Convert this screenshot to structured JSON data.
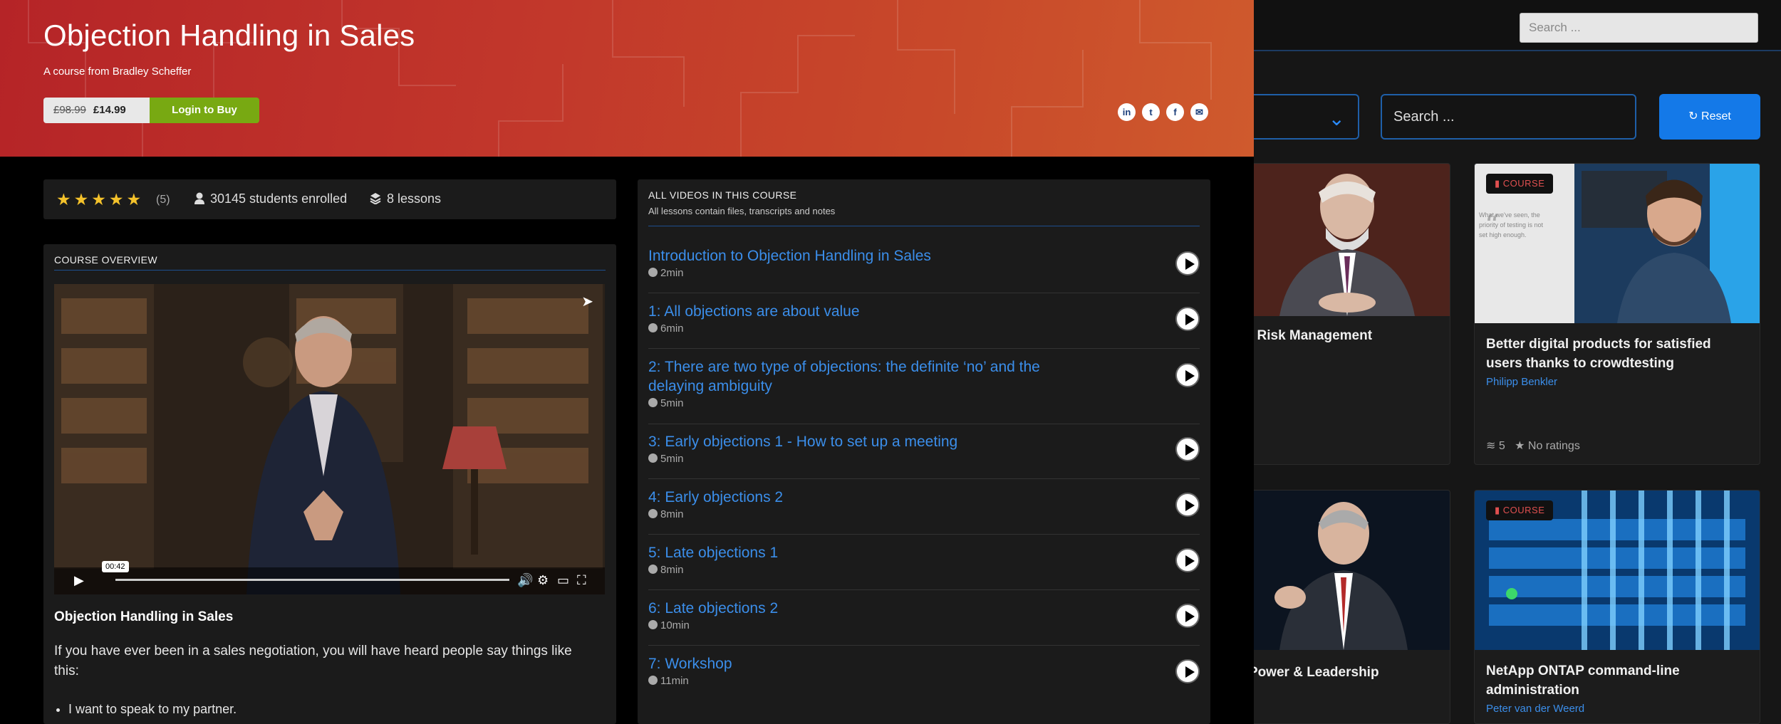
{
  "background": {
    "search_top_placeholder": "Search ...",
    "search_main_placeholder": "Search ...",
    "reset_label": "Reset",
    "cards": [
      {
        "title": "ctor: Risk Management",
        "author": "",
        "meta": "",
        "badge": ""
      },
      {
        "badge": "COURSE",
        "title": "Better digital products for satisfied users thanks to crowdtesting",
        "author": "Philipp Benkler",
        "lessons": "5",
        "rating": "No ratings"
      },
      {
        "title": "fer: Power & Leadership",
        "badge": ""
      },
      {
        "badge": "COURSE",
        "title": "NetApp ONTAP command-line administration",
        "author": "Peter van der Weerd"
      }
    ],
    "quote_text": "What we've seen, the priority of testing is not set high enough."
  },
  "course": {
    "title": "Objection Handling in Sales",
    "subtitle": "A course from Bradley Scheffer",
    "price_old": "£98.99",
    "price_new": "£14.99",
    "buy_label": "Login to Buy",
    "share_icons": [
      "linkedin-icon",
      "twitter-icon",
      "facebook-icon",
      "email-icon"
    ],
    "rating_count": "(5)",
    "students": "30145 students enrolled",
    "lessons_count": "8 lessons",
    "stars": 5
  },
  "overview": {
    "heading": "COURSE OVERVIEW",
    "video_time": "00:42",
    "title": "Objection Handling in Sales",
    "body": "If you have ever been in a sales negotiation, you will have  heard people say things like this:",
    "bullets": [
      "I want to speak to my partner."
    ]
  },
  "lessons": {
    "heading": "ALL VIDEOS IN THIS COURSE",
    "subheading": "All lessons contain files, transcripts and notes",
    "items": [
      {
        "title": "Introduction to Objection Handling in Sales",
        "duration": "2min"
      },
      {
        "title": "1: All objections are about value",
        "duration": "6min"
      },
      {
        "title": "2: There are two type of objections: the definite ‘no’ and the delaying ambiguity",
        "duration": "5min"
      },
      {
        "title": "3: Early objections 1 - How to set up a meeting",
        "duration": "5min"
      },
      {
        "title": "4: Early objections 2",
        "duration": "8min"
      },
      {
        "title": "5: Late objections 1",
        "duration": "8min"
      },
      {
        "title": "6: Late objections 2",
        "duration": "10min"
      },
      {
        "title": "7: Workshop",
        "duration": "11min"
      }
    ]
  }
}
